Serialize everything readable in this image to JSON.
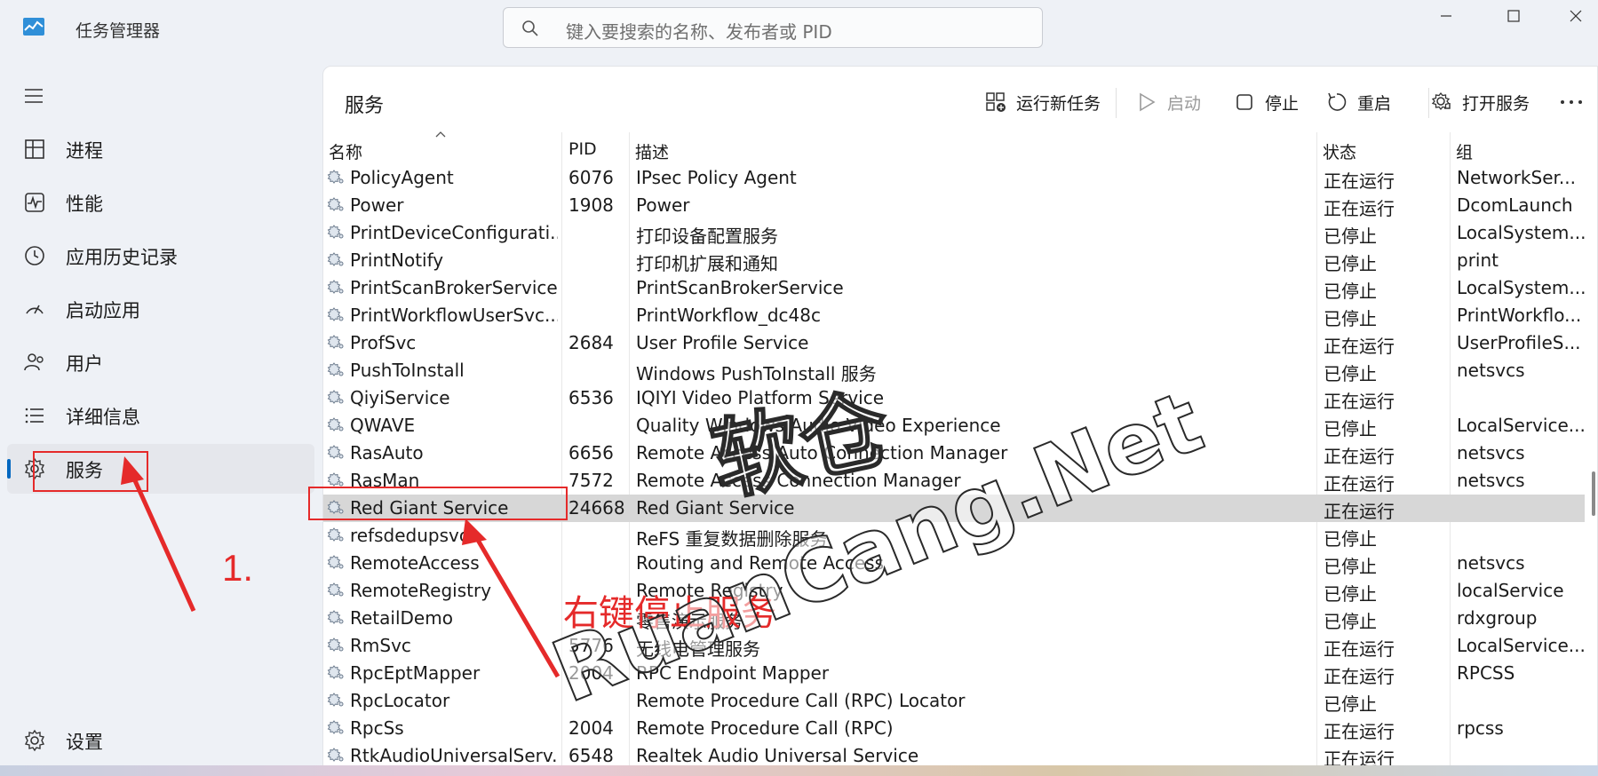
{
  "app": {
    "title": "任务管理器",
    "search_placeholder": "键入要搜索的名称、发布者或 PID"
  },
  "sidebar": {
    "items": [
      {
        "label": "进程",
        "icon": "processes-icon"
      },
      {
        "label": "性能",
        "icon": "performance-icon"
      },
      {
        "label": "应用历史记录",
        "icon": "app-history-icon"
      },
      {
        "label": "启动应用",
        "icon": "startup-icon"
      },
      {
        "label": "用户",
        "icon": "users-icon"
      },
      {
        "label": "详细信息",
        "icon": "details-icon"
      },
      {
        "label": "服务",
        "icon": "services-icon",
        "active": true
      }
    ],
    "settings_label": "设置"
  },
  "panel": {
    "title": "服务",
    "toolbar": {
      "run_new_task": "运行新任务",
      "start": "启动",
      "stop": "停止",
      "restart": "重启",
      "open_services": "打开服务"
    }
  },
  "table": {
    "columns": [
      "名称",
      "PID",
      "描述",
      "状态",
      "组"
    ],
    "rows": [
      {
        "name": "PolicyAgent",
        "pid": "6076",
        "desc": "IPsec Policy Agent",
        "status": "正在运行",
        "group": "NetworkSer..."
      },
      {
        "name": "Power",
        "pid": "1908",
        "desc": "Power",
        "status": "正在运行",
        "group": "DcomLaunch"
      },
      {
        "name": "PrintDeviceConfigurati...",
        "pid": "",
        "desc": "打印设备配置服务",
        "status": "已停止",
        "group": "LocalSystem..."
      },
      {
        "name": "PrintNotify",
        "pid": "",
        "desc": "打印机扩展和通知",
        "status": "已停止",
        "group": "print"
      },
      {
        "name": "PrintScanBrokerService",
        "pid": "",
        "desc": "PrintScanBrokerService",
        "status": "已停止",
        "group": "LocalSystem..."
      },
      {
        "name": "PrintWorkflowUserSvc...",
        "pid": "",
        "desc": "PrintWorkflow_dc48c",
        "status": "已停止",
        "group": "PrintWorkflo..."
      },
      {
        "name": "ProfSvc",
        "pid": "2684",
        "desc": "User Profile Service",
        "status": "正在运行",
        "group": "UserProfileS..."
      },
      {
        "name": "PushToInstall",
        "pid": "",
        "desc": "Windows PushToInstall 服务",
        "status": "已停止",
        "group": "netsvcs"
      },
      {
        "name": "QiyiService",
        "pid": "6536",
        "desc": "IQIYI Video Platform Service",
        "status": "正在运行",
        "group": ""
      },
      {
        "name": "QWAVE",
        "pid": "",
        "desc": "Quality Windows Audio Video Experience",
        "status": "已停止",
        "group": "LocalService..."
      },
      {
        "name": "RasAuto",
        "pid": "6656",
        "desc": "Remote Access Auto Connection Manager",
        "status": "正在运行",
        "group": "netsvcs"
      },
      {
        "name": "RasMan",
        "pid": "7572",
        "desc": "Remote Access Connection Manager",
        "status": "正在运行",
        "group": "netsvcs"
      },
      {
        "name": "Red Giant Service",
        "pid": "24668",
        "desc": "Red Giant Service",
        "status": "正在运行",
        "group": "",
        "selected": true
      },
      {
        "name": "refsdedupsvc",
        "pid": "",
        "desc": "ReFS 重复数据删除服务",
        "status": "已停止",
        "group": ""
      },
      {
        "name": "RemoteAccess",
        "pid": "",
        "desc": "Routing and Remote Access",
        "status": "已停止",
        "group": "netsvcs"
      },
      {
        "name": "RemoteRegistry",
        "pid": "",
        "desc": "Remote Registry",
        "status": "已停止",
        "group": "localService"
      },
      {
        "name": "RetailDemo",
        "pid": "",
        "desc": "零售演示服务",
        "status": "已停止",
        "group": "rdxgroup"
      },
      {
        "name": "RmSvc",
        "pid": "5776",
        "desc": "无线电管理服务",
        "status": "正在运行",
        "group": "LocalService..."
      },
      {
        "name": "RpcEptMapper",
        "pid": "2004",
        "desc": "RPC Endpoint Mapper",
        "status": "正在运行",
        "group": "RPCSS"
      },
      {
        "name": "RpcLocator",
        "pid": "",
        "desc": "Remote Procedure Call (RPC) Locator",
        "status": "已停止",
        "group": ""
      },
      {
        "name": "RpcSs",
        "pid": "2004",
        "desc": "Remote Procedure Call (RPC)",
        "status": "正在运行",
        "group": "rpcss"
      },
      {
        "name": "RtkAudioUniversalServ...",
        "pid": "6548",
        "desc": "Realtek Audio Universal Service",
        "status": "正在运行",
        "group": ""
      }
    ]
  },
  "annotations": {
    "step_number": "1.",
    "instruction": "右键停止服务",
    "watermark_line1": "软仓",
    "watermark_line2": "RuanCang.Net",
    "color": "#e52a2a"
  }
}
